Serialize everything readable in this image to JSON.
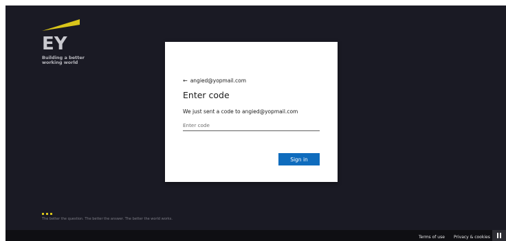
{
  "brand": {
    "logo_text": "EY",
    "tagline_line1": "Building a better",
    "tagline_line2": "working world",
    "bottom_tagline": "The better the question. The better the answer. The better the world works.",
    "accent_color": "#d9c51a"
  },
  "card": {
    "back_icon": "arrow-left-icon",
    "email": "angied@yopmail.com",
    "title": "Enter code",
    "description": "We just sent a code to angied@yopmail.com",
    "code_input_placeholder": "Enter code",
    "code_input_value": "",
    "sign_in_label": "Sign in",
    "button_color": "#0f6cbd"
  },
  "footer": {
    "terms_label": "Terms of use",
    "privacy_label": "Privacy & cookies",
    "pause_icon": "pause-icon"
  }
}
